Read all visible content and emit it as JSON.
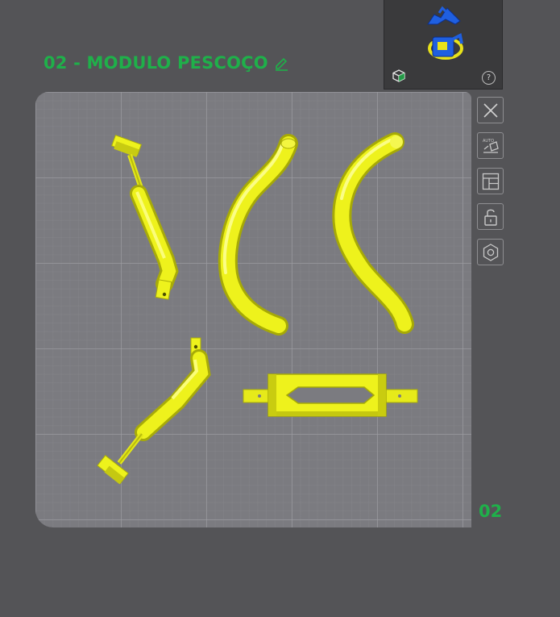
{
  "plate": {
    "title": "02 - MODULO PESCOÇO",
    "number": "02"
  },
  "preview": {
    "help_glyph": "?"
  },
  "toolbar": {
    "items": [
      "close-icon",
      "auto-orient-icon",
      "arrange-icon",
      "lock-icon",
      "plate-settings-icon"
    ]
  },
  "colors": {
    "background": "#545457",
    "bed": "#7b7b80",
    "accent": "#1fb04a",
    "model": "#eef21c",
    "thumbnail_model": "#1f5fe0"
  },
  "models": [
    "neck-rod-left",
    "curved-tube-center",
    "curved-tube-right",
    "neck-rod-bottom",
    "bracket-frame"
  ]
}
